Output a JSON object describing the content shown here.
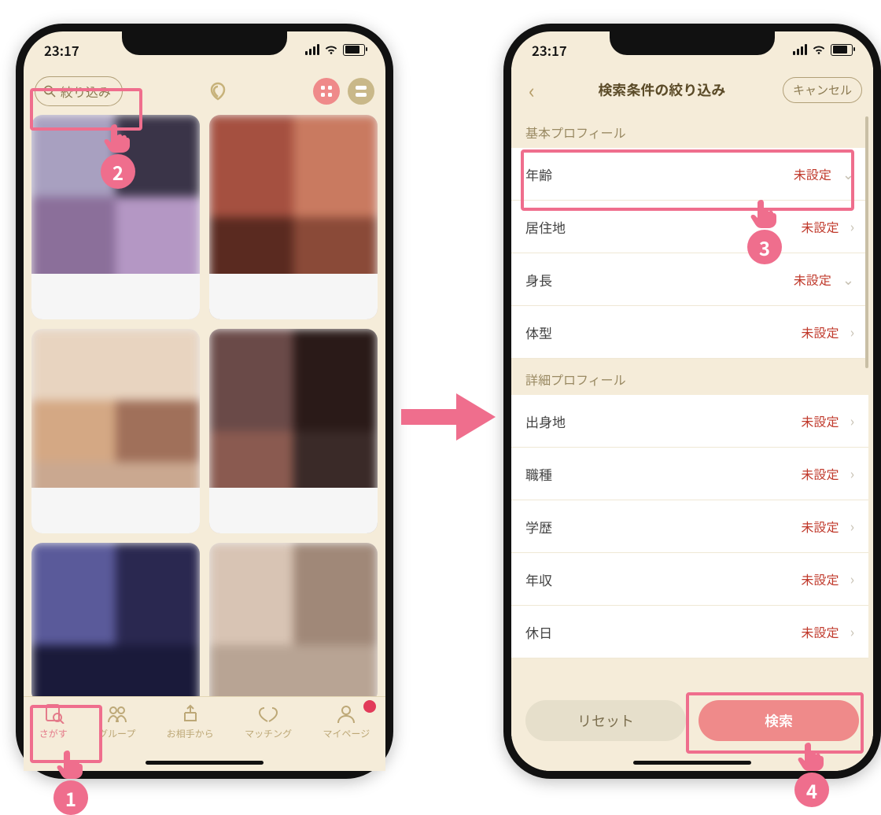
{
  "status": {
    "time": "23:17"
  },
  "left": {
    "filter_label": "絞り込み",
    "tabs": [
      {
        "label": "さがす"
      },
      {
        "label": "グループ"
      },
      {
        "label": "お相手から"
      },
      {
        "label": "マッチング"
      },
      {
        "label": "マイページ"
      }
    ]
  },
  "right": {
    "title": "検索条件の絞り込み",
    "cancel": "キャンセル",
    "sections": [
      {
        "title": "基本プロフィール",
        "rows": [
          {
            "label": "年齢",
            "value": "未設定",
            "chev": "v"
          },
          {
            "label": "居住地",
            "value": "未設定",
            "chev": ">"
          },
          {
            "label": "身長",
            "value": "未設定",
            "chev": "v"
          },
          {
            "label": "体型",
            "value": "未設定",
            "chev": ">"
          }
        ]
      },
      {
        "title": "詳細プロフィール",
        "rows": [
          {
            "label": "出身地",
            "value": "未設定",
            "chev": ">"
          },
          {
            "label": "職種",
            "value": "未設定",
            "chev": ">"
          },
          {
            "label": "学歴",
            "value": "未設定",
            "chev": ">"
          },
          {
            "label": "年収",
            "value": "未設定",
            "chev": ">"
          },
          {
            "label": "休日",
            "value": "未設定",
            "chev": ">"
          }
        ]
      }
    ],
    "reset": "リセット",
    "search": "検索"
  },
  "callouts": {
    "n1": "1",
    "n2": "2",
    "n3": "3",
    "n4": "4"
  }
}
